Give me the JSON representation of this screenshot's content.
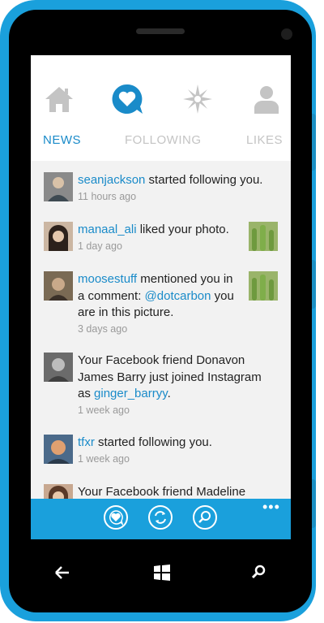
{
  "tabs": [
    {
      "label": "NEWS",
      "icon": "home-icon",
      "active": true
    },
    {
      "label": "FOLLOWING",
      "icon": "heart-bubble-icon",
      "active": false
    },
    {
      "label": "LIKES",
      "icon": "compass-icon",
      "active": false
    },
    {
      "label": "",
      "icon": "person-icon",
      "active": false
    }
  ],
  "feed": [
    {
      "user": "seanjackson",
      "text": " started following you.",
      "time": "11 hours ago"
    },
    {
      "user": "manaal_ali",
      "text": " liked your photo.",
      "time": "1 day ago"
    },
    {
      "user": "moosestuff",
      "text_before": " mentioned you in a comment: ",
      "mention": "@dotcarbon",
      "text_after": " you are in this picture.",
      "time": "3 days ago"
    },
    {
      "text_before": "Your Facebook friend Donavon James Barry just joined Instagram as ",
      "user": "ginger_barryy",
      "text_after": ".",
      "time": "1 week ago"
    },
    {
      "user": "tfxr",
      "text": " started following you.",
      "time": "1 week ago"
    },
    {
      "text": "Your Facebook friend Madeline"
    }
  ],
  "appbar": {
    "buttons": [
      "heart-bubble-icon",
      "refresh-icon",
      "search-icon"
    ],
    "more": "•••"
  },
  "colors": {
    "accent": "#1aa0dc",
    "link": "#1a8bc9"
  }
}
